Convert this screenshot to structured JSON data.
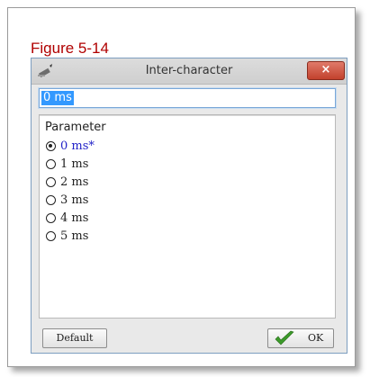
{
  "figure_caption": "Figure 5-14",
  "dialog": {
    "title": "Inter-character",
    "close_label": "×",
    "value_text": "0 ms",
    "list_header": "Parameter",
    "options": [
      {
        "label": "0 ms*",
        "selected": true
      },
      {
        "label": "1 ms",
        "selected": false
      },
      {
        "label": "2 ms",
        "selected": false
      },
      {
        "label": "3 ms",
        "selected": false
      },
      {
        "label": "4 ms",
        "selected": false
      },
      {
        "label": "5 ms",
        "selected": false
      }
    ],
    "default_button": "Default",
    "ok_button": "OK"
  },
  "colors": {
    "caption": "#b00000",
    "selected_option": "#2323c8",
    "input_highlight": "#3399ff",
    "ok_check": "#3c9a2a"
  },
  "icons": {
    "app": "pen-icon",
    "ok": "checkmark-icon"
  }
}
